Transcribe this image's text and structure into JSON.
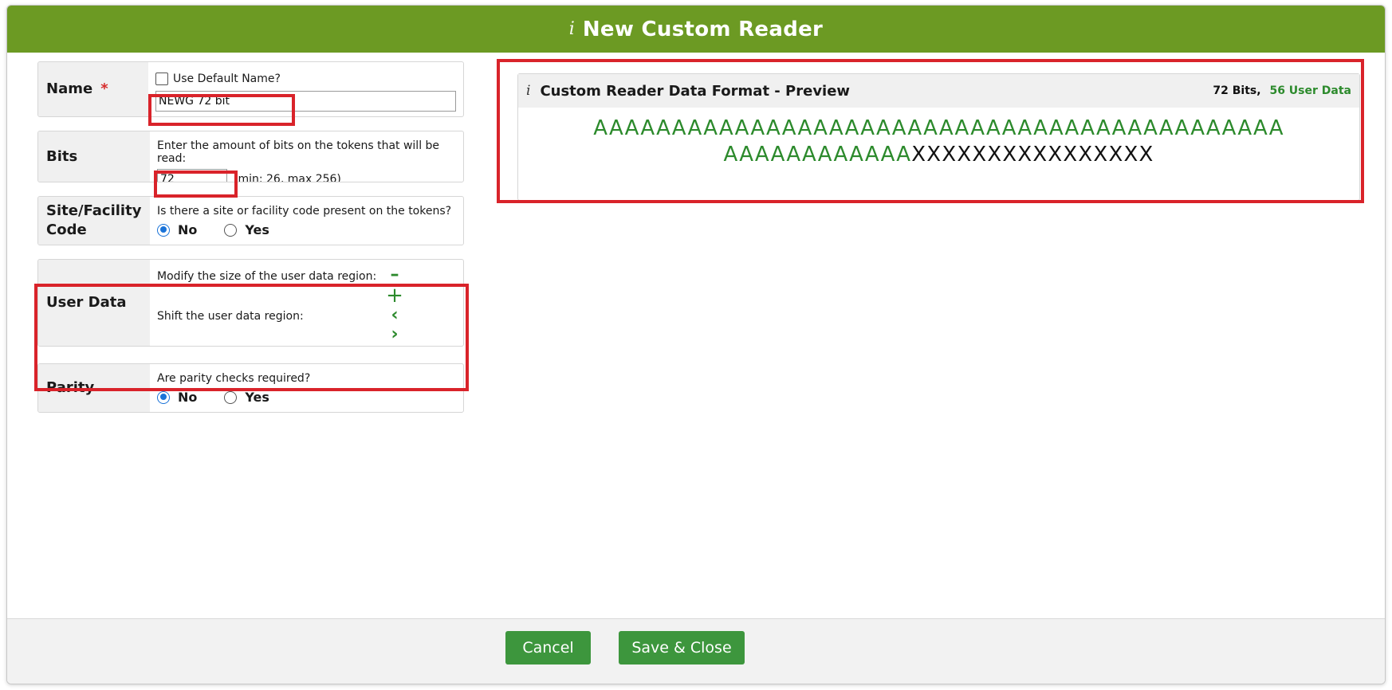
{
  "dialog": {
    "title": "New Custom Reader",
    "title_icon": "info-icon"
  },
  "name_section": {
    "label": "Name",
    "required_marker": "*",
    "use_default_label": "Use Default Name?",
    "use_default_checked": false,
    "value": "NEWG 72 bit"
  },
  "bits_section": {
    "label": "Bits",
    "prompt": "Enter the amount of bits on the tokens that will be read:",
    "value": "72",
    "hint": "(min: 26, max 256)"
  },
  "site_section": {
    "label_line1": "Site/Facility",
    "label_line2": "Code",
    "question": "Is there a site or facility code present on the tokens?",
    "options": [
      "No",
      "Yes"
    ],
    "selected": "No"
  },
  "user_data_section": {
    "label": "User Data",
    "modify_label": "Modify the size of the user data region:",
    "shift_label": "Shift the user data region:",
    "icons": [
      "minus-icon",
      "plus-icon",
      "chevron-left-icon",
      "chevron-right-icon"
    ]
  },
  "parity_section": {
    "label": "Parity",
    "question": "Are parity checks required?",
    "options": [
      "No",
      "Yes"
    ],
    "selected": "No"
  },
  "preview": {
    "title": "Custom Reader Data Format - Preview",
    "bits_text": "72 Bits,",
    "user_data_text": "56 User Data",
    "line1_a": "AAAAAAAAAAAAAAAAAAAAAAAAAAAAAAAAAAAAAAAAAAAA",
    "line2_a": "AAAAAAAAAAAA",
    "line2_x": "XXXXXXXXXXXXXXXX"
  },
  "footer": {
    "cancel_label": "Cancel",
    "save_label": "Save & Close"
  },
  "colors": {
    "header_green": "#6c9a23",
    "button_green": "#3d963d",
    "data_green": "#2c8a2c",
    "highlight_red": "#d9232a",
    "radio_blue": "#1a73d8"
  }
}
